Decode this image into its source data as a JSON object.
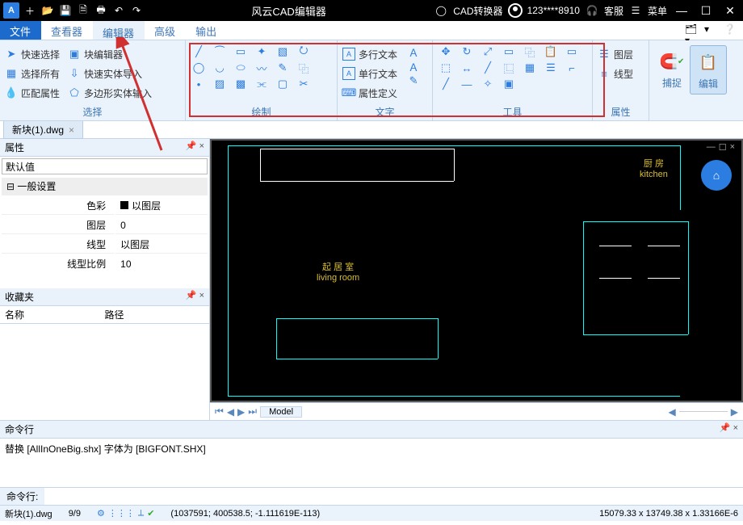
{
  "titlebar": {
    "app_title": "风云CAD编辑器",
    "converter": "CAD转换器",
    "user_id": "123****8910",
    "support": "客服",
    "menu": "菜单"
  },
  "menu": {
    "file": "文件",
    "viewer": "查看器",
    "editor": "编辑器",
    "advanced": "高级",
    "output": "输出"
  },
  "ribbon": {
    "select_panel": {
      "title": "选择",
      "quick_select": "快速选择",
      "select_all": "选择所有",
      "match_attr": "匹配属性",
      "block_editor": "块编辑器",
      "quick_entity_import": "快速实体导入",
      "polygon_entity_input": "多边形实体输入"
    },
    "draw_panel": "绘制",
    "text_panel": {
      "title": "文字",
      "mtext": "多行文本",
      "stext": "单行文本",
      "attrdef": "属性定义"
    },
    "tool_panel": "工具",
    "prop_panel": {
      "title": "属性",
      "layers": "图层",
      "linetype": "线型"
    },
    "snap": {
      "label": "捕捉"
    },
    "edit": {
      "label": "编辑"
    }
  },
  "doctab": {
    "name": "新块(1).dwg"
  },
  "sidebar": {
    "prop_title": "属性",
    "default_value": "默认值",
    "group": "一般设置",
    "rows": {
      "color": {
        "label": "色彩",
        "value": "以图层"
      },
      "layer": {
        "label": "图层",
        "value": "0"
      },
      "linetype": {
        "label": "线型",
        "value": "以图层"
      },
      "ltscale": {
        "label": "线型比例",
        "value": "10"
      }
    },
    "fav_title": "收藏夹",
    "col_name": "名称",
    "col_path": "路径"
  },
  "canvas": {
    "living_cn": "起 居 室",
    "living_en": "living room",
    "kitchen_cn": "厨 房",
    "kitchen_en": "kitchen",
    "tab_model": "Model"
  },
  "cmd": {
    "title": "命令行",
    "history": "替换 [AllInOneBig.shx] 字体为 [BIGFONT.SHX]",
    "prompt": "命令行:"
  },
  "status": {
    "file": "新块(1).dwg",
    "page": "9/9",
    "coords": "(1037591; 400538.5; -1.111619E-113)",
    "dims": "15079.33 x 13749.38 x 1.33166E-6"
  }
}
